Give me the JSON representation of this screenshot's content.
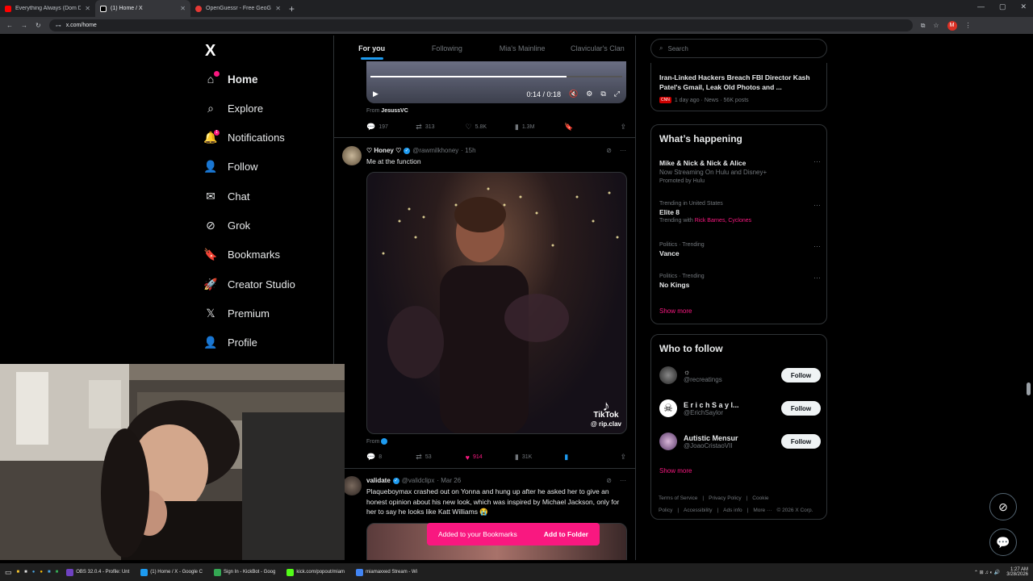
{
  "browser": {
    "tabs": [
      {
        "title": "Everything Always (Dom D",
        "color": "#ff0000"
      },
      {
        "title": "(1) Home / X",
        "color": "#ffffff"
      },
      {
        "title": "OpenGuessr - Free GeoGue",
        "color": "#e53935"
      }
    ],
    "url": "x.com/home",
    "profile_initial": "M"
  },
  "nav": {
    "logo": "X",
    "items": [
      {
        "label": "Home",
        "icon": "home-icon"
      },
      {
        "label": "Explore",
        "icon": "search-icon"
      },
      {
        "label": "Notifications",
        "icon": "bell-icon",
        "badge": "1"
      },
      {
        "label": "Follow",
        "icon": "add-person-icon"
      },
      {
        "label": "Chat",
        "icon": "mail-icon"
      },
      {
        "label": "Grok",
        "icon": "grok-icon"
      },
      {
        "label": "Bookmarks",
        "icon": "bookmark-icon"
      },
      {
        "label": "Creator Studio",
        "icon": "rocket-icon"
      },
      {
        "label": "Premium",
        "icon": "x-logo-icon"
      },
      {
        "label": "Profile",
        "icon": "person-icon"
      }
    ]
  },
  "timeline": {
    "tabs": [
      "For you",
      "Following",
      "Mia's Mainline",
      "Clavicular's Clan"
    ],
    "video_time": "0:14 / 0:18",
    "video_progress": 0.78,
    "post1": {
      "from_label": "From",
      "from_name": "JesussVC",
      "replies": "197",
      "reposts": "313",
      "likes": "5.8K",
      "views": "1.3M"
    },
    "post2": {
      "name": "♡ Honey ♡",
      "handle": "@rawmilkhoney",
      "time": "· 15h",
      "text": "Me at the function",
      "tiktok": "TikTok",
      "tiktok_handle": "@ rip.clav",
      "from_label": "From",
      "replies": "8",
      "reposts": "53",
      "likes": "914",
      "views": "31K"
    },
    "post3": {
      "name": "validate",
      "handle": "@validclipx",
      "time": "· Mar 26",
      "text": "Plaqueboymax crashed out on Yonna and hung up after he asked her to give an honest opinion about his new look, which was inspired by Michael Jackson, only for her to say he looks like Katt Williams 😭"
    },
    "toast": {
      "message": "Added to your Bookmarks",
      "action": "Add to Folder"
    }
  },
  "right": {
    "search_placeholder": "Search",
    "news": {
      "headline": "Iran-Linked Hackers Breach FBI Director Kash Patel's Gmail, Leak Old Photos and ...",
      "meta": "1 day ago · News · 56K posts"
    },
    "happening": {
      "title": "What’s happening",
      "trends": [
        {
          "context": "",
          "title": "Mike & Nick & Nick & Alice",
          "sub": "Now Streaming On Hulu and Disney+",
          "extra": "Promoted by Hulu"
        },
        {
          "context": "Trending in United States",
          "title": "Elite 8",
          "sub": "Trending with",
          "links": "Rick Barnes, Cyclones"
        },
        {
          "context": "Politics · Trending",
          "title": "Vance"
        },
        {
          "context": "Politics · Trending",
          "title": "No Kings"
        }
      ],
      "show_more": "Show more"
    },
    "who_to_follow": {
      "title": "Who to follow",
      "accounts": [
        {
          "name": "☼",
          "handle": "@recreatings"
        },
        {
          "name": "E r i c h S a y l...",
          "handle": "@ErichSaylor"
        },
        {
          "name": "Autistic Mensur",
          "handle": "@JoaoCristaoVII"
        }
      ],
      "button": "Follow",
      "show_more": "Show more"
    },
    "footer": [
      "Terms of Service",
      "|",
      "Privacy Policy",
      "|",
      "Cookie Policy",
      "|",
      "Accessibility",
      "|",
      "Ads info",
      "|",
      "More ···",
      "© 2026 X Corp."
    ]
  },
  "taskbar": {
    "items": [
      "OBS 32.0.4 - Profile: Unt",
      "(1) Home / X - Google C",
      "Sign In - KickBot - Goog",
      "kick.com/popout/miam",
      "miamaxxed Stream - Wi"
    ],
    "time": "1:27 AM",
    "date": "3/28/2026"
  },
  "colors": {
    "accent": "#1d9bf0",
    "pink": "#f91880",
    "bg": "#000000"
  }
}
